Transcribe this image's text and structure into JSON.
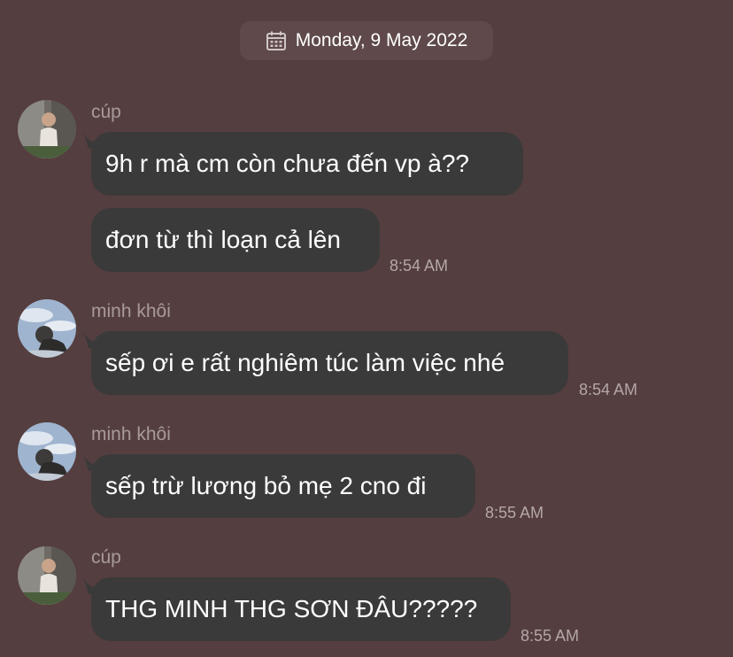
{
  "date_header": {
    "icon": "calendar-icon",
    "text": "Monday, 9 May 2022"
  },
  "messages": [
    {
      "sender": "cúp",
      "avatar": "avatar-cup",
      "bubbles": [
        {
          "text": "9h r mà cm còn chưa đến vp à??"
        },
        {
          "text": "đơn từ thì loạn cả lên",
          "time": "8:54 AM"
        }
      ]
    },
    {
      "sender": "minh khôi",
      "avatar": "avatar-minh-khoi",
      "bubbles": [
        {
          "text": "sếp ơi e rất nghiêm túc làm việc nhé",
          "time": "8:54 AM"
        }
      ]
    },
    {
      "sender": "minh khôi",
      "avatar": "avatar-minh-khoi",
      "bubbles": [
        {
          "text": "sếp trừ lương bỏ mẹ 2 cno đi",
          "time": "8:55 AM"
        }
      ]
    },
    {
      "sender": "cúp",
      "avatar": "avatar-cup",
      "bubbles": [
        {
          "text": "THG MINH THG SƠN ĐÂU?????",
          "time": "8:55 AM"
        }
      ]
    }
  ],
  "colors": {
    "background": "#553e3f",
    "bubble": "#3b3a3b",
    "sender_name": "#a89a9a",
    "timestamp": "#b3a7a7",
    "text": "#ffffff"
  }
}
